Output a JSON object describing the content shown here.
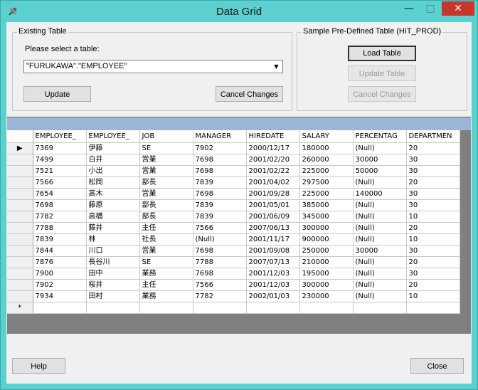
{
  "window": {
    "title": "Data Grid",
    "minimize_glyph": "—",
    "maximize_glyph": "□",
    "close_glyph": "✕"
  },
  "existing_table": {
    "legend": "Existing Table",
    "prompt": "Please select a table:",
    "selected_table": "\"FURUKAWA\".\"EMPLOYEE\"",
    "update_label": "Update",
    "cancel_label": "Cancel Changes"
  },
  "sample_table": {
    "legend": "Sample Pre-Defined Table (HIT_PROD)",
    "load_label": "Load Table",
    "update_label": "Update Table",
    "cancel_label": "Cancel Changes"
  },
  "grid": {
    "columns": [
      "EMPLOYEE_",
      "EMPLOYEE_",
      "JOB",
      "MANAGER",
      "HIREDATE",
      "SALARY",
      "PERCENTAG",
      "DEPARTMEN"
    ],
    "rows": [
      [
        "7369",
        "伊藤",
        "SE",
        "7902",
        "2000/12/17",
        "180000",
        "(Null)",
        "20"
      ],
      [
        "7499",
        "白井",
        "営業",
        "7698",
        "2001/02/20",
        "260000",
        "30000",
        "30"
      ],
      [
        "7521",
        "小出",
        "営業",
        "7698",
        "2001/02/22",
        "225000",
        "50000",
        "30"
      ],
      [
        "7566",
        "松岡",
        "部長",
        "7839",
        "2001/04/02",
        "297500",
        "(Null)",
        "20"
      ],
      [
        "7654",
        "高木",
        "営業",
        "7698",
        "2001/09/28",
        "225000",
        "140000",
        "30"
      ],
      [
        "7698",
        "藤原",
        "部長",
        "7839",
        "2001/05/01",
        "385000",
        "(Null)",
        "30"
      ],
      [
        "7782",
        "高橋",
        "部長",
        "7839",
        "2001/06/09",
        "345000",
        "(Null)",
        "10"
      ],
      [
        "7788",
        "藤井",
        "主任",
        "7566",
        "2007/06/13",
        "300000",
        "(Null)",
        "20"
      ],
      [
        "7839",
        "林",
        "社長",
        "(Null)",
        "2001/11/17",
        "900000",
        "(Null)",
        "10"
      ],
      [
        "7844",
        "川口",
        "営業",
        "7698",
        "2001/09/08",
        "250000",
        "30000",
        "30"
      ],
      [
        "7876",
        "長谷川",
        "SE",
        "7788",
        "2007/07/13",
        "210000",
        "(Null)",
        "20"
      ],
      [
        "7900",
        "田中",
        "業務",
        "7698",
        "2001/12/03",
        "195000",
        "(Null)",
        "30"
      ],
      [
        "7902",
        "桜井",
        "主任",
        "7566",
        "2001/12/03",
        "300000",
        "(Null)",
        "20"
      ],
      [
        "7934",
        "田村",
        "業務",
        "7782",
        "2002/01/03",
        "230000",
        "(Null)",
        "10"
      ]
    ],
    "current_row_marker": "▶",
    "new_row_marker": "*"
  },
  "footer": {
    "help_label": "Help",
    "close_label": "Close"
  }
}
